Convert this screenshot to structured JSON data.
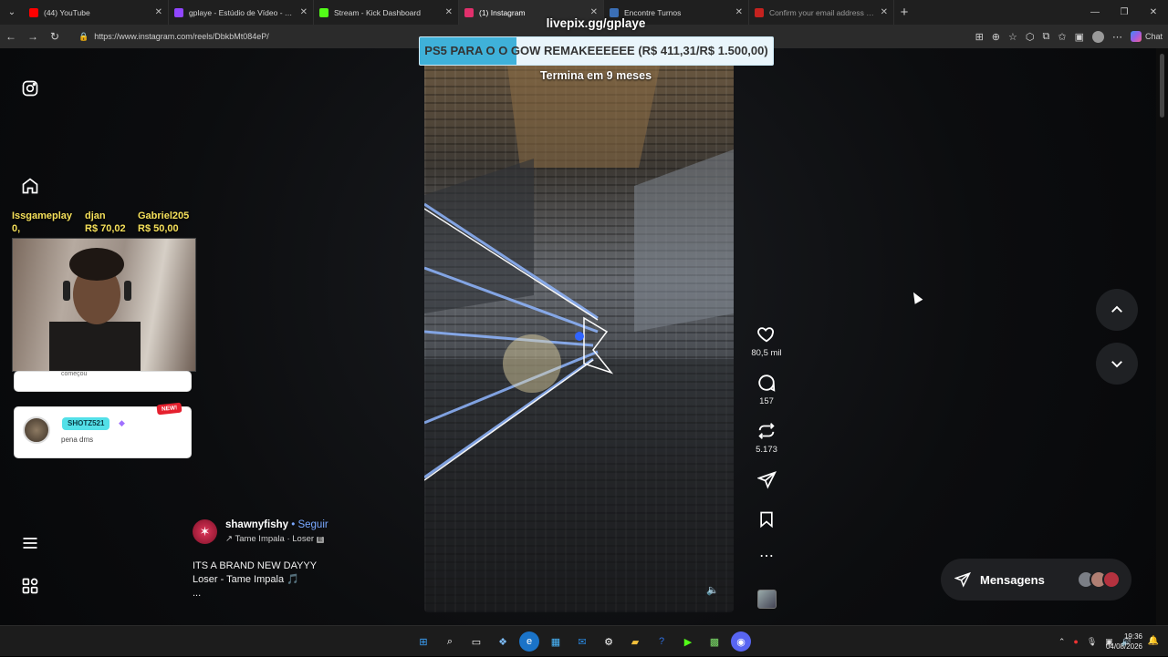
{
  "browser": {
    "tabs": [
      {
        "title": "(44) YouTube",
        "color": "#ff0000"
      },
      {
        "title": "gplaye - Estúdio de Vídeo - Twitch",
        "color": "#9146ff"
      },
      {
        "title": "Stream - Kick Dashboard",
        "color": "#53fc18"
      },
      {
        "title": "(1) Instagram",
        "color": "#e1306c"
      },
      {
        "title": "Encontre Turnos",
        "color": "#3b6fb6"
      },
      {
        "title": "Confirm your email address on Ar",
        "color": "#c5221f"
      }
    ],
    "url": "https://www.instagram.com/reels/DbkbMt084eP/",
    "chat_label": "Chat"
  },
  "overlay": {
    "livepix_url": "livepix.gg/gplaye",
    "goal_text": "PS5 PARA O O GOW REMAKEEEEEE (R$ 411,31/R$ 1.500,00)",
    "goal_progress": 0.274,
    "goal_deadline": "Termina em 9 meses",
    "donors": [
      {
        "name": "Issgameplay",
        "amount": "0,"
      },
      {
        "name": "djan",
        "amount": "R$ 70,02"
      },
      {
        "name": "Gabriel205",
        "amount": "R$ 50,00"
      }
    ],
    "chat_prev_msg": "começou",
    "chat_user": "SHOTZ521",
    "chat_msg": "pena dms",
    "chat_new": "NEW!"
  },
  "reel": {
    "likes": "80,5 mil",
    "comments": "157",
    "reposts": "5.173",
    "username": "shawnyfishy",
    "follow": "Seguir",
    "separator": "•",
    "music": "Tame Impala · Loser",
    "caption_line1": "ITS A BRAND NEW DAYYY",
    "caption_line2": "Loser - Tame Impala 🎵",
    "caption_more": "..."
  },
  "messages_label": "Mensagens",
  "clock": {
    "time": "19:36",
    "date": "04/08/2026"
  }
}
